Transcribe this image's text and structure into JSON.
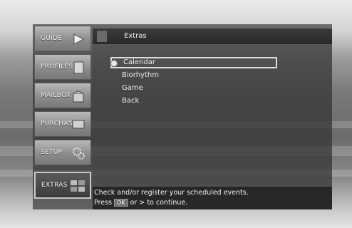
{
  "sidebar": {
    "items": [
      {
        "label": "GUIDE",
        "icon": "arrow-right-icon",
        "active": false
      },
      {
        "label": "PROFILES",
        "icon": "profile-card-icon",
        "active": false
      },
      {
        "label": "MAILBOX",
        "icon": "mailbox-icon",
        "active": false
      },
      {
        "label": "PURCHASES",
        "icon": "purchase-screen-icon",
        "active": false
      },
      {
        "label": "SETUP",
        "icon": "gears-icon",
        "active": false
      },
      {
        "label": "EXTRAS",
        "icon": "extras-tiles-icon",
        "active": true
      }
    ]
  },
  "header": {
    "title": "Extras"
  },
  "menu": {
    "items": [
      {
        "label": "Calendar",
        "selected": true
      },
      {
        "label": "Biorhythm",
        "selected": false
      },
      {
        "label": "Game",
        "selected": false
      },
      {
        "label": "Back",
        "selected": false
      }
    ]
  },
  "status": {
    "line1": "Check and/or register your scheduled events.",
    "line2_prefix": "Press",
    "line2_key": "OK",
    "line2_suffix": "or > to continue."
  }
}
